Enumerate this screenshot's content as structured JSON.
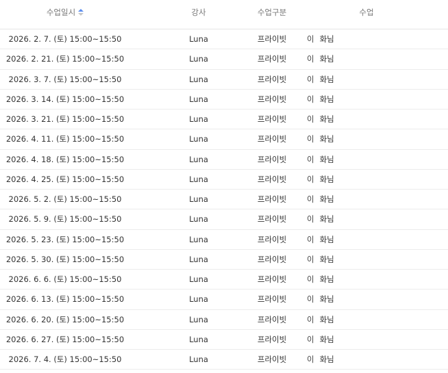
{
  "header": {
    "date": "수업일시",
    "teacher": "강사",
    "type": "수업구분",
    "class": "수업"
  },
  "rows": [
    {
      "date": "2026. 2. 7. (토) 15:00~15:50",
      "teacher": "Luna",
      "type": "프라이빗",
      "class_a": "이",
      "class_b": "화님"
    },
    {
      "date": "2026. 2. 21. (토) 15:00~15:50",
      "teacher": "Luna",
      "type": "프라이빗",
      "class_a": "이",
      "class_b": "화님"
    },
    {
      "date": "2026. 3. 7. (토) 15:00~15:50",
      "teacher": "Luna",
      "type": "프라이빗",
      "class_a": "이",
      "class_b": "화님"
    },
    {
      "date": "2026. 3. 14. (토) 15:00~15:50",
      "teacher": "Luna",
      "type": "프라이빗",
      "class_a": "이",
      "class_b": "화님"
    },
    {
      "date": "2026. 3. 21. (토) 15:00~15:50",
      "teacher": "Luna",
      "type": "프라이빗",
      "class_a": "이",
      "class_b": "화님"
    },
    {
      "date": "2026. 4. 11. (토) 15:00~15:50",
      "teacher": "Luna",
      "type": "프라이빗",
      "class_a": "이",
      "class_b": "화님"
    },
    {
      "date": "2026. 4. 18. (토) 15:00~15:50",
      "teacher": "Luna",
      "type": "프라이빗",
      "class_a": "이",
      "class_b": "화님"
    },
    {
      "date": "2026. 4. 25. (토) 15:00~15:50",
      "teacher": "Luna",
      "type": "프라이빗",
      "class_a": "이",
      "class_b": "화님"
    },
    {
      "date": "2026. 5. 2. (토) 15:00~15:50",
      "teacher": "Luna",
      "type": "프라이빗",
      "class_a": "이",
      "class_b": "화님"
    },
    {
      "date": "2026. 5. 9. (토) 15:00~15:50",
      "teacher": "Luna",
      "type": "프라이빗",
      "class_a": "이",
      "class_b": "화님"
    },
    {
      "date": "2026. 5. 23. (토) 15:00~15:50",
      "teacher": "Luna",
      "type": "프라이빗",
      "class_a": "이",
      "class_b": "화님"
    },
    {
      "date": "2026. 5. 30. (토) 15:00~15:50",
      "teacher": "Luna",
      "type": "프라이빗",
      "class_a": "이",
      "class_b": "화님"
    },
    {
      "date": "2026. 6. 6. (토) 15:00~15:50",
      "teacher": "Luna",
      "type": "프라이빗",
      "class_a": "이",
      "class_b": "화님"
    },
    {
      "date": "2026. 6. 13. (토) 15:00~15:50",
      "teacher": "Luna",
      "type": "프라이빗",
      "class_a": "이",
      "class_b": "화님"
    },
    {
      "date": "2026. 6. 20. (토) 15:00~15:50",
      "teacher": "Luna",
      "type": "프라이빗",
      "class_a": "이",
      "class_b": "화님"
    },
    {
      "date": "2026. 6. 27. (토) 15:00~15:50",
      "teacher": "Luna",
      "type": "프라이빗",
      "class_a": "이",
      "class_b": "화님"
    },
    {
      "date": "2026. 7. 4. (토) 15:00~15:50",
      "teacher": "Luna",
      "type": "프라이빗",
      "class_a": "이",
      "class_b": "화님"
    }
  ]
}
